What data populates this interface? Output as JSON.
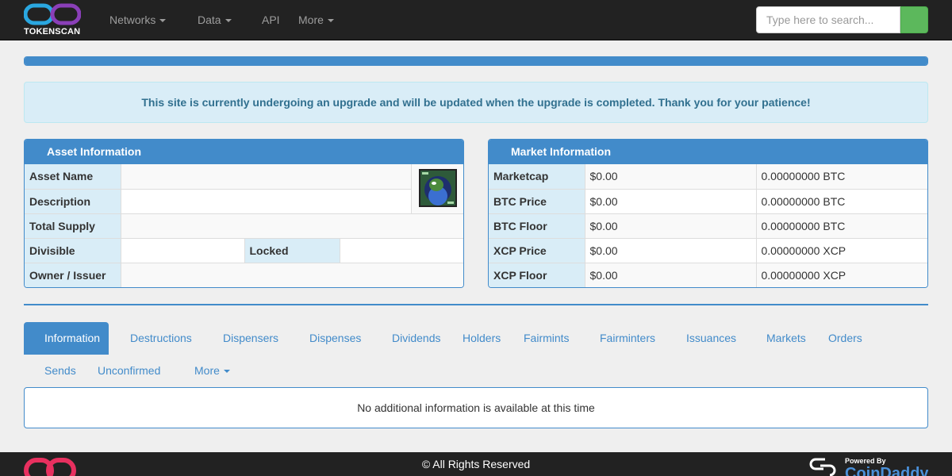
{
  "brand": {
    "name": "TOKENSCAN"
  },
  "nav": {
    "networks": "Networks",
    "data": "Data",
    "api": "API",
    "more": "More"
  },
  "search": {
    "placeholder": "Type here to search..."
  },
  "progress": {
    "percent": 100
  },
  "notice": {
    "text": "This site is currently undergoing an upgrade and will be updated when the upgrade is completed. Thank you for your patience!"
  },
  "asset_panel": {
    "title": "Asset Information",
    "labels": {
      "asset_name": "Asset Name",
      "description": "Description",
      "total_supply": "Total Supply",
      "divisible": "Divisible",
      "locked": "Locked",
      "owner_issuer": "Owner / Issuer"
    }
  },
  "market_panel": {
    "title": "Market Information",
    "rows": [
      {
        "label": "Marketcap",
        "usd": "$0.00",
        "native": "0.00000000 BTC"
      },
      {
        "label": "BTC Price",
        "usd": "$0.00",
        "native": "0.00000000 BTC"
      },
      {
        "label": "BTC Floor",
        "usd": "$0.00",
        "native": "0.00000000 BTC"
      },
      {
        "label": "XCP Price",
        "usd": "$0.00",
        "native": "0.00000000 XCP"
      },
      {
        "label": "XCP Floor",
        "usd": "$0.00",
        "native": "0.00000000 XCP"
      }
    ]
  },
  "tabs": {
    "information": "Information",
    "destructions": "Destructions",
    "dispensers": "Dispensers",
    "dispenses": "Dispenses",
    "dividends": "Dividends",
    "holders": "Holders",
    "fairmints": "Fairmints",
    "fairminters": "Fairminters",
    "issuances": "Issuances",
    "markets": "Markets",
    "orders": "Orders",
    "sends": "Sends",
    "unconfirmed": "Unconfirmed",
    "more": "More"
  },
  "info_box": {
    "text": "No additional information is available at this time"
  },
  "footer": {
    "copyright": "© All Rights Reserved",
    "powered_label": "Powered By",
    "powered_brand": "CoinDaddy"
  },
  "colors": {
    "accent": "#428bca",
    "navbar": "#222222",
    "search_button": "#5cb85c",
    "label_bg": "#d9edf7",
    "notice_text": "#31708f"
  }
}
